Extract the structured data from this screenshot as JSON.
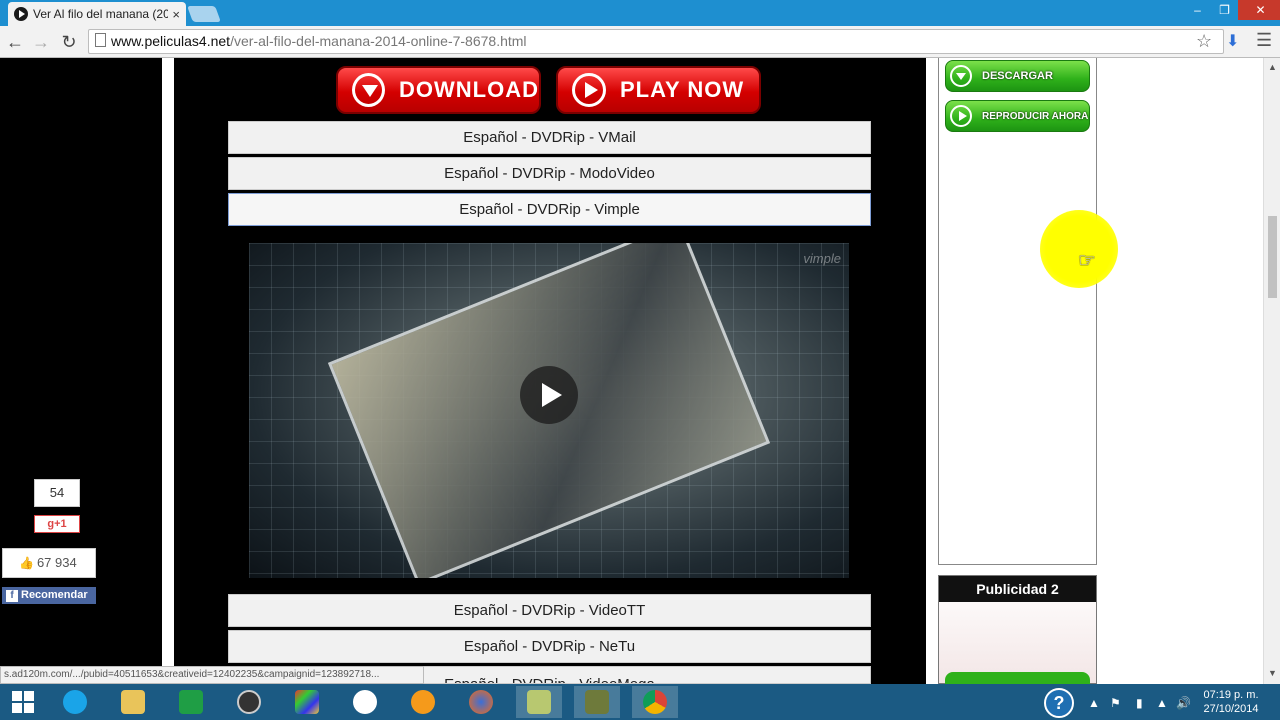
{
  "browser": {
    "tab_title": "Ver Al filo del manana (20",
    "tab_close": "×",
    "url_domain": "www.peliculas4.net",
    "url_path": "/ver-al-filo-del-manana-2014-online-7-8678.html",
    "window_controls": {
      "minimize": "–",
      "restore": "❐",
      "close": "✕"
    }
  },
  "page": {
    "download_label": "DOWNLOAD",
    "play_now_label": "PLAY NOW",
    "servers_top": [
      "Español - DVDRip - VMail",
      "Español - DVDRip - ModoVideo",
      "Español - DVDRip - Vimple"
    ],
    "servers_bottom": [
      "Español - DVDRip - VideoTT",
      "Español - DVDRip - NeTu",
      "Español - DVDRip - VideoMega"
    ],
    "video_watermark": "vimple"
  },
  "social": {
    "share_count": "54",
    "gplus_label": "g+1",
    "like_count": "67 934",
    "recommend_label": "Recomendar"
  },
  "sidebar": {
    "descargar_label": "DESCARGAR",
    "reproducir_label": "REPRODUCIR AHORA",
    "ad_title": "Publicidad 2"
  },
  "status_url": "s.ad120m.com/.../pubid=40511653&creativeid=12402235&campaignid=123892718...",
  "taskbar": {
    "time": "07:19 p. m.",
    "date": "27/10/2014",
    "help": "?"
  },
  "colors": {
    "red_button": "#d40000",
    "green_button": "#2fb11a",
    "taskbar": "#1b5a83"
  }
}
